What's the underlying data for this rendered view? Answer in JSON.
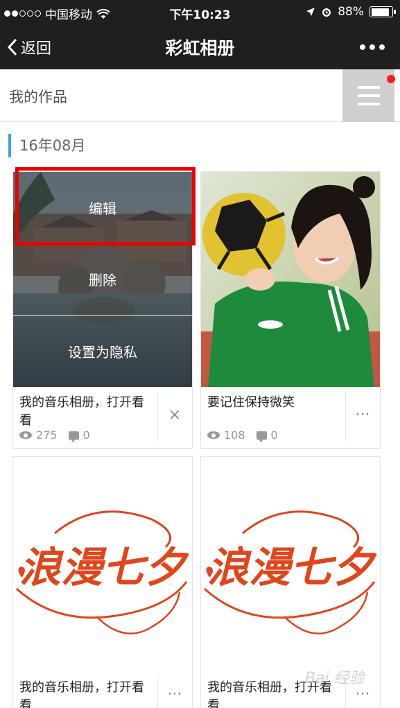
{
  "status_bar": {
    "carrier": "中国移动",
    "time": "下午10:23",
    "battery": "88%",
    "signal_bars_filled": 2,
    "signal_bars_total": 5
  },
  "nav": {
    "back_label": "返回",
    "title": "彩虹相册"
  },
  "subheader": {
    "label": "我的作品"
  },
  "section": {
    "month": "16年08月"
  },
  "cards": [
    {
      "caption": "我的音乐相册，打开看看",
      "views": "275",
      "comments": "0",
      "action": "×",
      "menu": [
        "编辑",
        "删除",
        "设置为隐私"
      ]
    },
    {
      "caption": "要记住保持微笑",
      "views": "108",
      "comments": "0",
      "action": "···"
    },
    {
      "caption": "我的音乐相册，打开看看",
      "action": "···",
      "art_text": "浪漫七夕"
    },
    {
      "caption": "我的音乐相册，打开看看",
      "action": "···",
      "art_text": "浪漫七夕"
    }
  ],
  "colors": {
    "bar_bg": "#1f1f1f",
    "accent": "#3aa0e8",
    "badge": "#ff1a1a",
    "highlight": "#ee0000",
    "art": "#e0451c"
  },
  "watermark": "Bai 经验"
}
